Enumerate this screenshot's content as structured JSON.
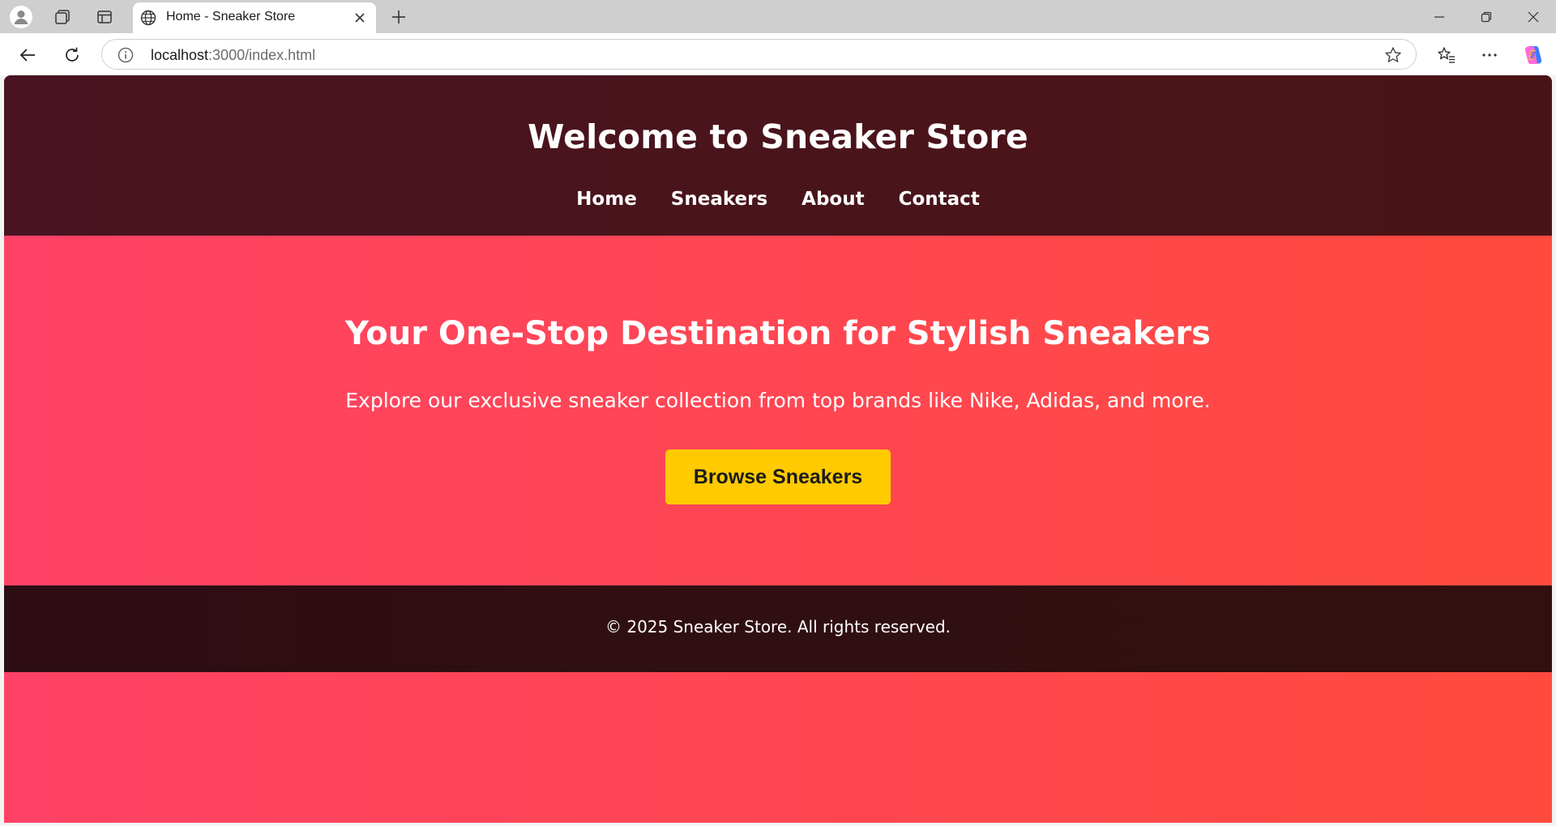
{
  "browser": {
    "tab": {
      "title": "Home - Sneaker Store",
      "icon": "globe-icon"
    },
    "address": {
      "host": "localhost",
      "path": ":3000/index.html"
    },
    "icons": {
      "profile": "profile-icon",
      "collections": "collections-icon",
      "sidebar": "sidebar-icon",
      "back": "back-arrow-icon",
      "reload": "reload-icon",
      "info": "info-icon",
      "star": "star-icon",
      "favorites": "favorites-icon",
      "more": "more-icon",
      "copilot": "copilot-icon"
    }
  },
  "site": {
    "title": "Welcome to Sneaker Store",
    "nav": [
      "Home",
      "Sneakers",
      "About",
      "Contact"
    ],
    "hero": {
      "heading": "Your One-Stop Destination for Stylish Sneakers",
      "subheading": "Explore our exclusive sneaker collection from top brands like Nike, Adidas, and more.",
      "cta": "Browse Sneakers"
    },
    "footer": "© 2025 Sneaker Store. All rights reserved."
  },
  "colors": {
    "header_bg": "#4a1420",
    "hero_gradient_start": "#ff4266",
    "hero_gradient_end": "#ff4a3e",
    "cta_bg": "#ffca00",
    "footer_bg": "#301012"
  }
}
